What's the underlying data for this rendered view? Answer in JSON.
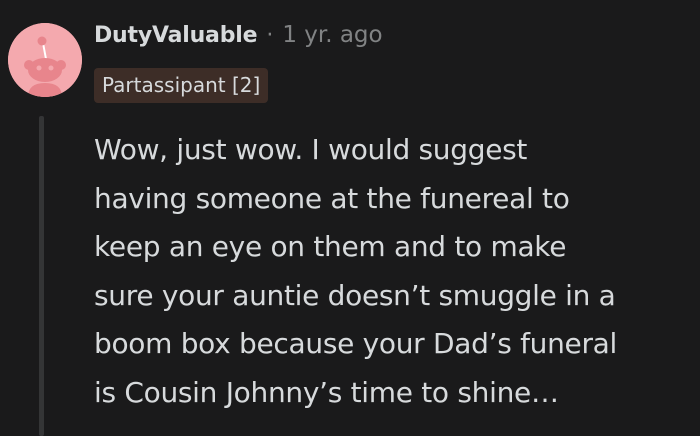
{
  "comment": {
    "avatar_icon": "reddit-snoo-avatar-icon",
    "author": "DutyValuable",
    "separator": "·",
    "timestamp": "1 yr. ago",
    "flair": "Partassipant [2]",
    "body_lines": [
      "Wow, just wow. I would suggest",
      "having someone at the funereal to",
      "keep an eye on them and to make",
      "sure your auntie doesn’t smuggle in a",
      "boom box because your Dad’s funeral",
      "is Cousin Johnny’s time to shine…"
    ]
  },
  "colors": {
    "background": "#1a1a1b",
    "avatar_bg": "#f4a9ae",
    "flair_bg": "#3d2d27",
    "text_primary": "#d7dadc",
    "text_muted": "#818384"
  }
}
